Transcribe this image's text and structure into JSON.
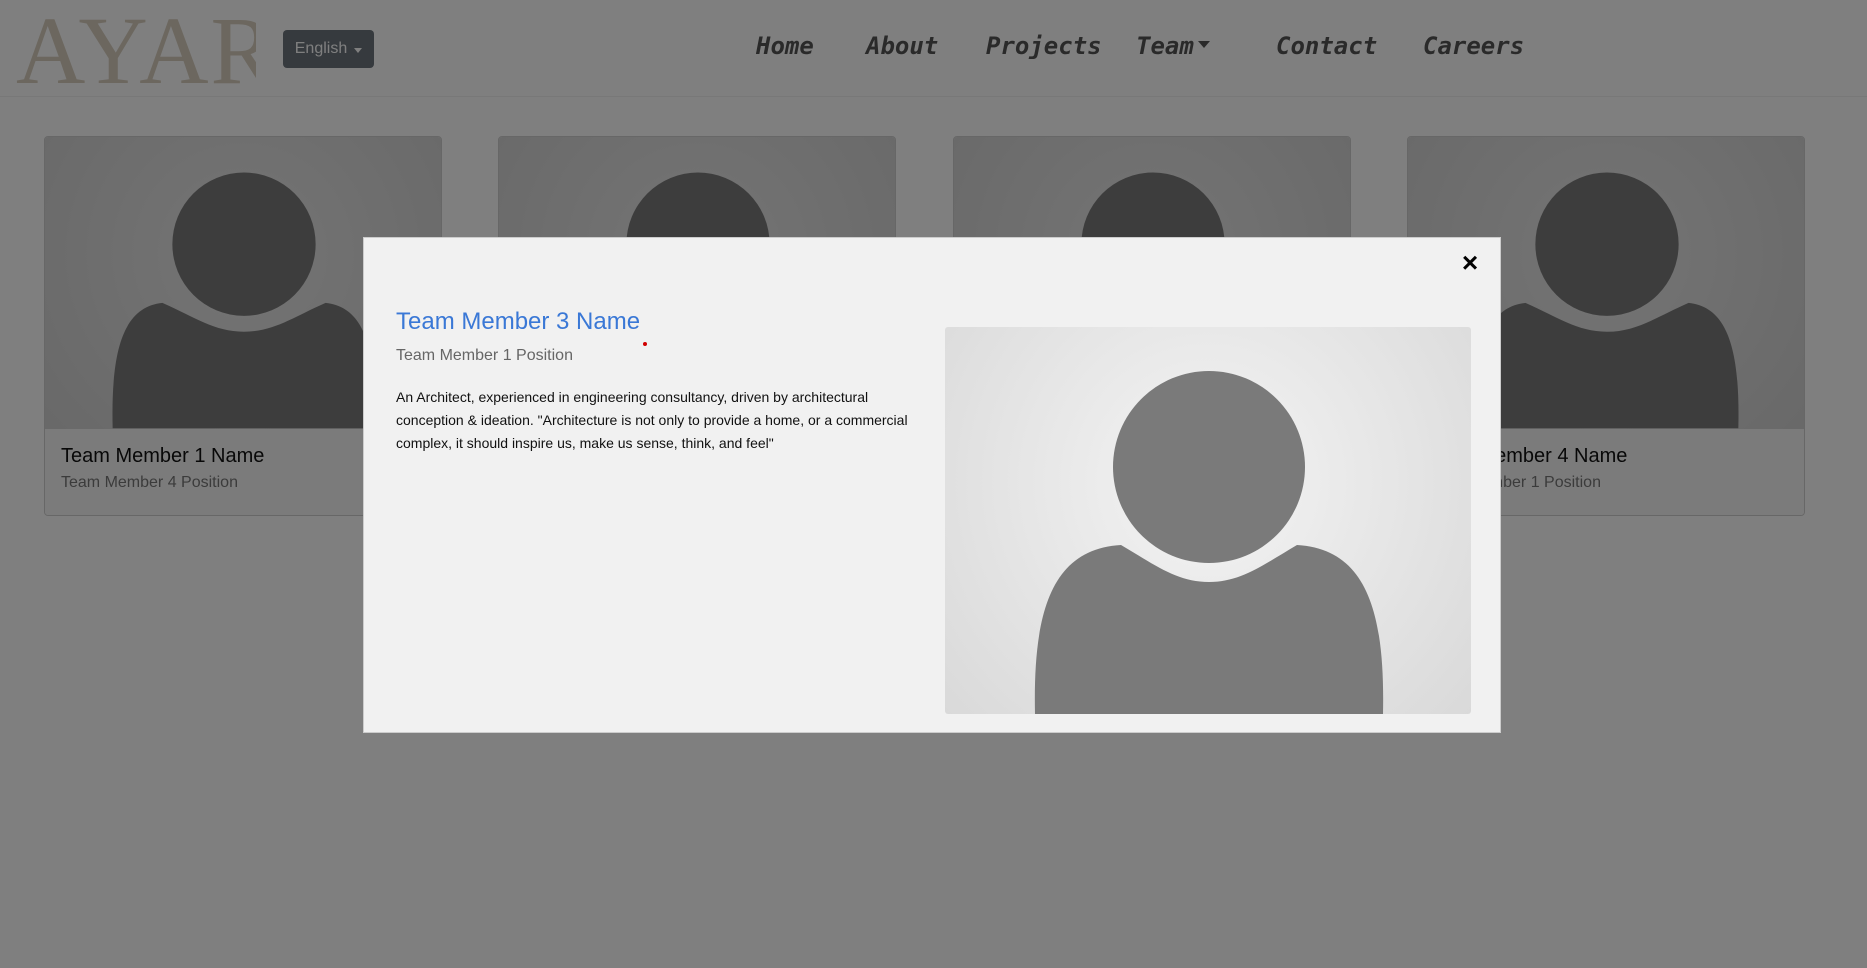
{
  "header": {
    "logo_text": "AYAR",
    "language_button": "English",
    "nav": [
      {
        "label": "Home"
      },
      {
        "label": "About"
      },
      {
        "label": "Projects"
      },
      {
        "label": "Team"
      },
      {
        "label": "Contact"
      },
      {
        "label": "Careers"
      }
    ]
  },
  "cards": [
    {
      "name": "Team Member 1 Name",
      "position": "Team Member 4 Position"
    },
    {
      "name": "",
      "position": ""
    },
    {
      "name": "",
      "position": ""
    },
    {
      "name": "Team Member 4 Name",
      "position": "Team Member 1 Position"
    }
  ],
  "modal": {
    "close_icon": "×",
    "name": "Team Member 3 Name",
    "position": "Team Member 1 Position",
    "description": "An Architect, experienced in engineering consultancy, driven by architectural conception & ideation. \"Architecture is not only to provide a home, or a commercial complex, it should inspire us, make us sense, think, and feel\""
  },
  "colors": {
    "accent": "#3a78d6",
    "overlay": "rgba(0,0,0,0.5)",
    "silhouette": "#7a7a7a",
    "lang_button_bg": "#6c757d",
    "logo": "#d8cfbf"
  }
}
